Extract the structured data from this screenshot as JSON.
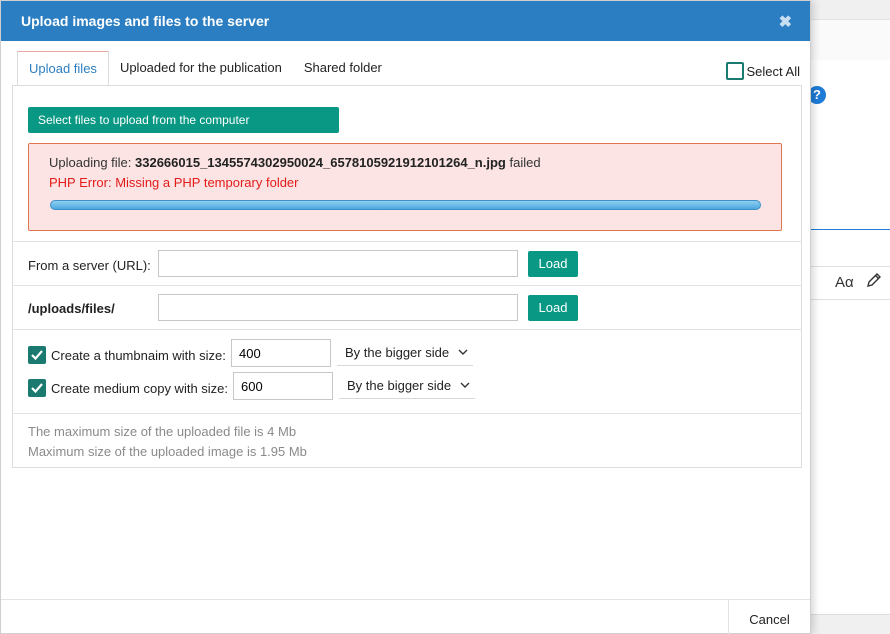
{
  "dialog": {
    "title": "Upload images and files to the server",
    "close_glyph": "✖"
  },
  "tabs": [
    {
      "label": "Upload files",
      "active": true
    },
    {
      "label": "Uploaded for the publication",
      "active": false
    },
    {
      "label": "Shared folder",
      "active": false
    }
  ],
  "select_all": {
    "label": "Select All",
    "checked": false
  },
  "upload": {
    "select_button": "Select files to upload from the computer",
    "status_prefix": "Uploading file: ",
    "file_name": "332666015_1345574302950024_6578105921912101264_n.jpg",
    "status_suffix": " failed",
    "error_message": "PHP Error: Missing a PHP temporary folder",
    "progress": 1.0
  },
  "server_url": {
    "label": "From a server (URL):",
    "value": "",
    "load_label": "Load"
  },
  "uploads_path": {
    "label": "/uploads/files/",
    "value": "",
    "load_label": "Load"
  },
  "thumbnail": {
    "label": "Create a thumbnaim with size:",
    "checked": true,
    "size": "400",
    "mode": "By the bigger side"
  },
  "medium": {
    "label": "Create medium copy with size:",
    "checked": true,
    "size": "600",
    "mode": "By the bigger side"
  },
  "limits": {
    "file_limit": "The maximum size of the uploaded file is 4 Mb",
    "image_limit": "Maximum size of the uploaded image is 1.95 Mb"
  },
  "footer": {
    "cancel_label": "Cancel"
  },
  "background": {
    "text_style_label": "Aα",
    "help_glyph": "?"
  },
  "colors": {
    "title_bar": "#2b7ec1",
    "primary_button": "#089883",
    "error_text": "#e31b1b",
    "error_bg": "#fbe4e3"
  }
}
